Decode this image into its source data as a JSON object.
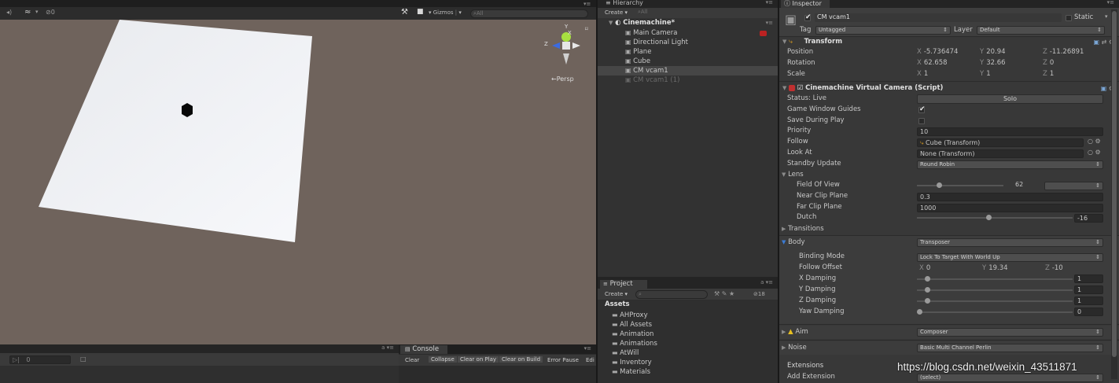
{
  "scene": {
    "toolbar": {
      "audio": "◂)",
      "fx": "≈",
      "fx_caret": "▾",
      "hidden_count": "0",
      "tools_icon": "⚒",
      "camera_icon": "■",
      "gizmos": "Gizmos",
      "gizmos_caret": "▾",
      "search_placeholder": "⌕All",
      "menu": "▾≡"
    },
    "persp_label": "←Persp",
    "gizmo": {
      "y": "Y",
      "x": "X",
      "z": "Z"
    },
    "lock": "⌑"
  },
  "bottom_left": {
    "play_icon": "▷|",
    "count": "0",
    "search_icon": "□",
    "lock": "a ▾≡"
  },
  "console": {
    "tab": "Console",
    "buttons": [
      "Clear",
      "Collapse",
      "Clear on Play",
      "Clear on Build",
      "Error Pause",
      "Edi"
    ],
    "menu": "▾≡"
  },
  "hierarchy": {
    "tab": "Hierarchy",
    "create": "Create ▾",
    "search": "⌕All",
    "scene_name": "Cinemachine*",
    "items": [
      {
        "label": "Main Camera",
        "active": true
      },
      {
        "label": "Directional Light",
        "active": true
      },
      {
        "label": "Plane",
        "active": true
      },
      {
        "label": "Cube",
        "active": true
      },
      {
        "label": "CM vcam1",
        "active": true
      },
      {
        "label": "CM vcam1 (1)",
        "active": false
      }
    ]
  },
  "project": {
    "tab": "Project",
    "create": "Create ▾",
    "hidden_count": "18",
    "root": "Assets",
    "folders": [
      "AHProxy",
      "All Assets",
      "Animation",
      "Animations",
      "AtWill",
      "Inventory",
      "Materials"
    ]
  },
  "inspector": {
    "tab": "Inspector",
    "object_name": "CM vcam1",
    "static_label": "Static",
    "tag_label": "Tag",
    "tag_value": "Untagged",
    "layer_label": "Layer",
    "layer_value": "Default",
    "transform": {
      "title": "Transform",
      "rows": [
        {
          "label": "Position",
          "x": "-5.736474",
          "y": "20.94",
          "z": "-11.26891"
        },
        {
          "label": "Rotation",
          "x": "62.658",
          "y": "32.66",
          "z": "0"
        },
        {
          "label": "Scale",
          "x": "1",
          "y": "1",
          "z": "1"
        }
      ]
    },
    "vcam": {
      "title": "Cinemachine Virtual Camera (Script)",
      "status": "Status: Live",
      "solo": "Solo",
      "game_window_guides": "Game Window Guides",
      "save_during_play": "Save During Play",
      "priority_label": "Priority",
      "priority": "10",
      "follow_label": "Follow",
      "follow": "Cube (Transform)",
      "look_at_label": "Look At",
      "look_at": "None (Transform)",
      "standby_label": "Standby Update",
      "standby": "Round Robin",
      "lens": "Lens",
      "fov_label": "Field Of View",
      "fov": "62",
      "fov_pos": 0.24,
      "near_label": "Near Clip Plane",
      "near": "0.3",
      "far_label": "Far Clip Plane",
      "far": "1000",
      "dutch_label": "Dutch",
      "dutch": "-16",
      "dutch_pos": 0.46,
      "transitions": "Transitions",
      "body_label": "Body",
      "body": "Transposer",
      "binding_label": "Binding Mode",
      "binding": "Lock To Target With World Up",
      "offset_label": "Follow Offset",
      "offset": {
        "x": "0",
        "y": "19.34",
        "z": "-10"
      },
      "damping": [
        {
          "label": "X Damping",
          "value": "1",
          "pos": 0.05
        },
        {
          "label": "Y Damping",
          "value": "1",
          "pos": 0.05
        },
        {
          "label": "Z Damping",
          "value": "1",
          "pos": 0.05
        },
        {
          "label": "Yaw Damping",
          "value": "0",
          "pos": 0.0
        }
      ],
      "aim_label": "Aim",
      "aim": "Composer",
      "noise_label": "Noise",
      "noise": "Basic Multi Channel Perlin",
      "extensions": "Extensions",
      "add_extension_label": "Add Extension",
      "add_extension": "(select)"
    }
  },
  "watermark": "https://blog.csdn.net/weixin_43511871"
}
